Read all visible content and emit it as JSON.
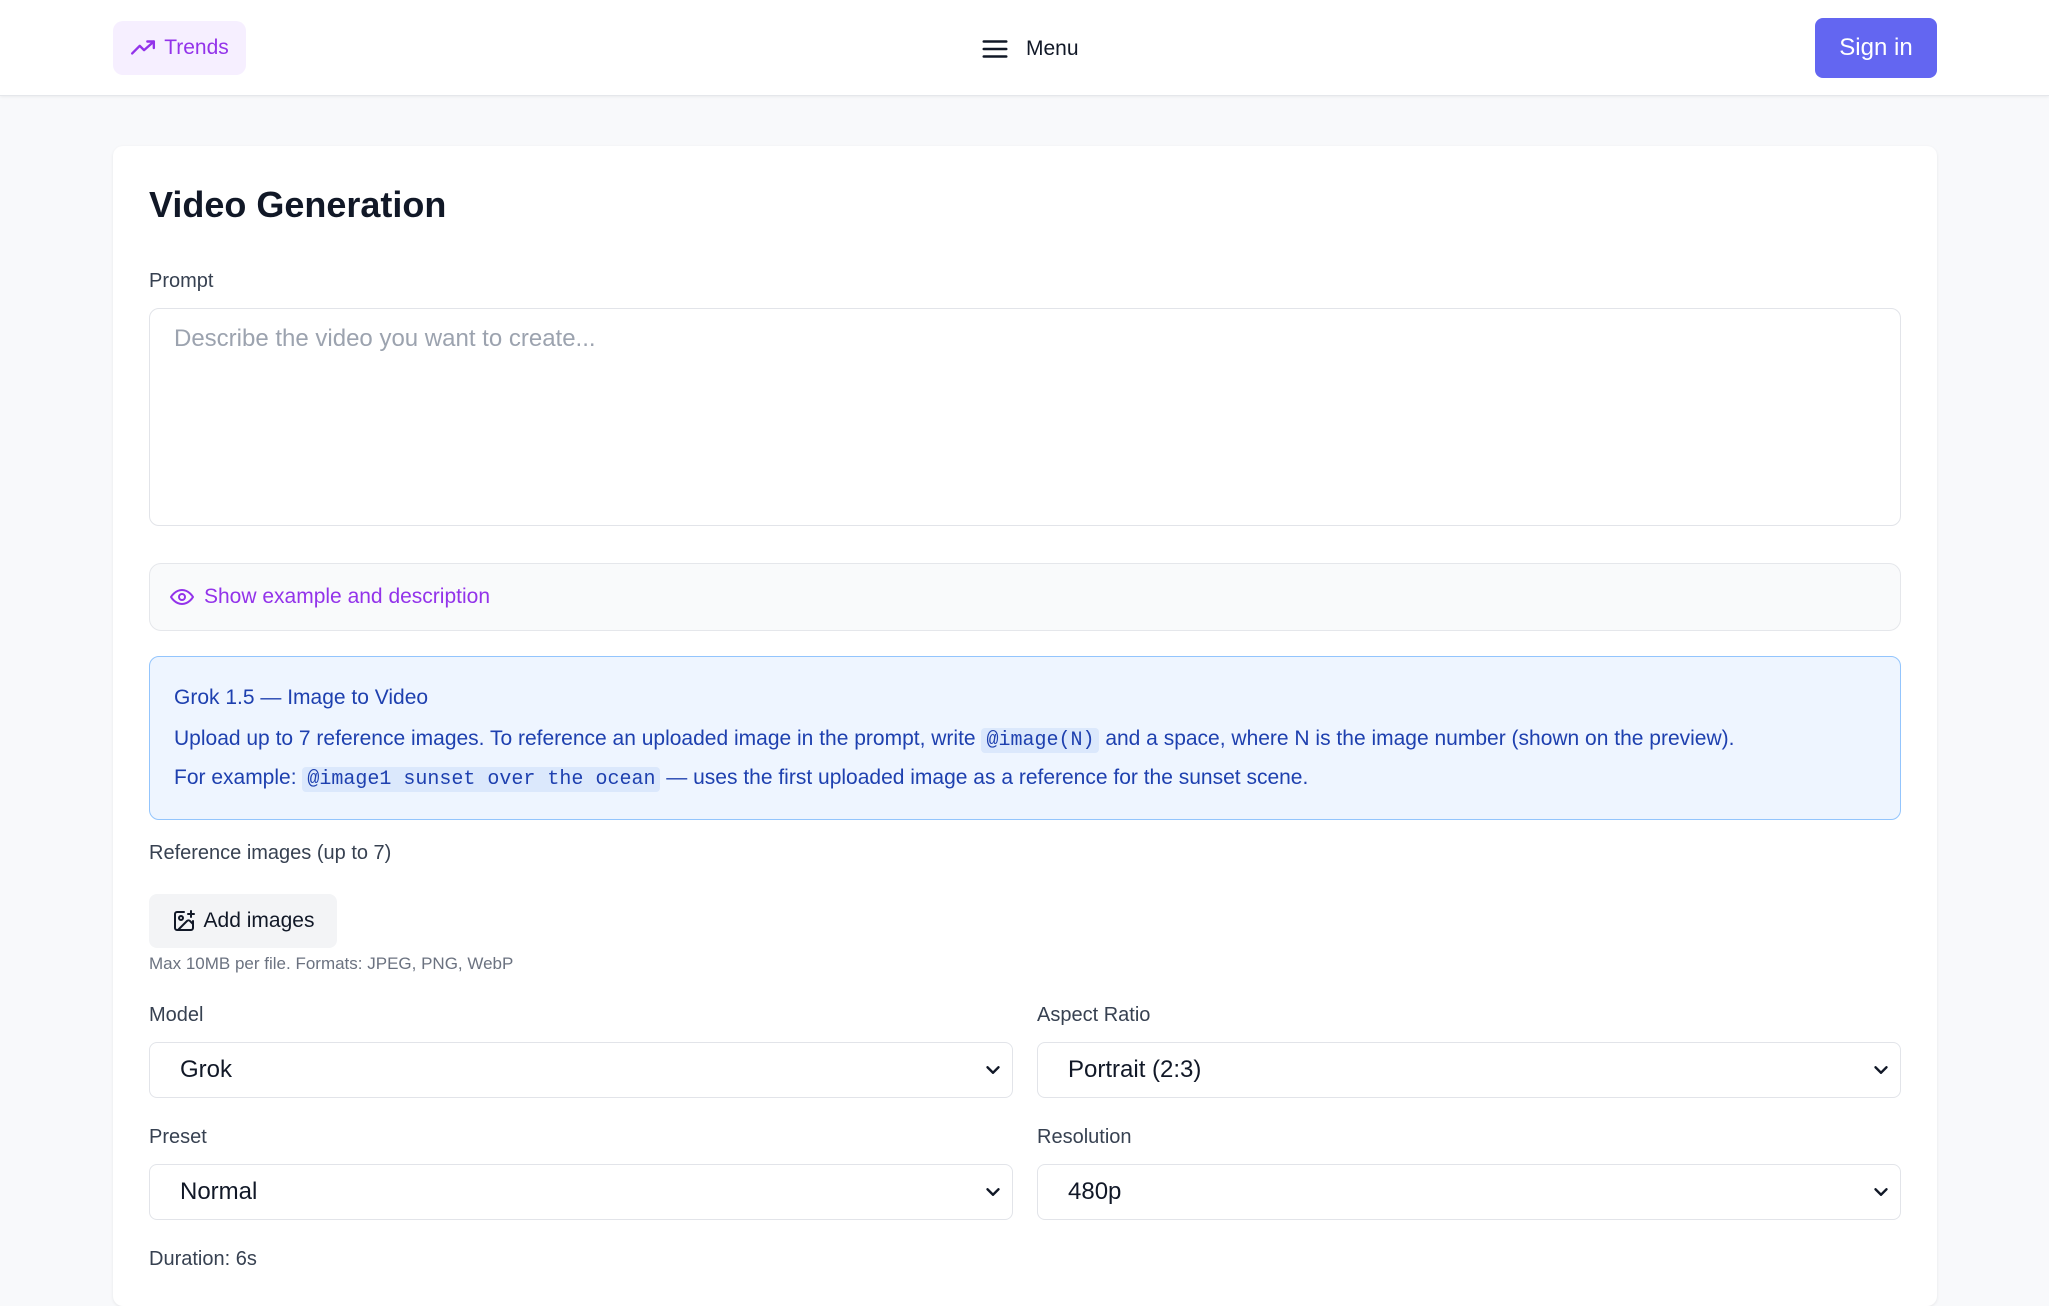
{
  "header": {
    "trends_label": "Trends",
    "menu_label": "Menu",
    "signin_label": "Sign in"
  },
  "form": {
    "title": "Video Generation",
    "prompt_label": "Prompt",
    "prompt_placeholder": "Describe the video you want to create...",
    "prompt_value": "",
    "example_toggle_label": "Show example and description",
    "info": {
      "title": "Grok 1.5 — Image to Video",
      "line1_pre": "Upload up to 7 reference images. To reference an uploaded image in the prompt, write",
      "line1_code": "@image(N)",
      "line1_post": "and a space, where N is the image number (shown on the preview).",
      "line2_pre": "For example:",
      "line2_code": "@image1 sunset over the ocean",
      "line2_post": "— uses the first uploaded image as a reference for the sunset scene."
    },
    "reference_label": "Reference images (up to 7)",
    "add_images_label": "Add images",
    "file_hint": "Max 10MB per file. Formats: JPEG, PNG, WebP",
    "model": {
      "label": "Model",
      "value": "Grok"
    },
    "aspect_ratio": {
      "label": "Aspect Ratio",
      "value": "Portrait (2:3)"
    },
    "preset": {
      "label": "Preset",
      "value": "Normal"
    },
    "resolution": {
      "label": "Resolution",
      "value": "480p"
    },
    "duration_label": "Duration: 6s"
  },
  "colors": {
    "accent_purple": "#9333ea",
    "signin_bg": "#6366f1",
    "info_bg": "#eef5ff",
    "info_text": "#1e40af"
  },
  "icons": {
    "trends": "trending-up-icon",
    "menu": "hamburger-icon",
    "example": "eye-icon",
    "add_images": "image-plus-icon",
    "select": "chevron-down-icon"
  }
}
